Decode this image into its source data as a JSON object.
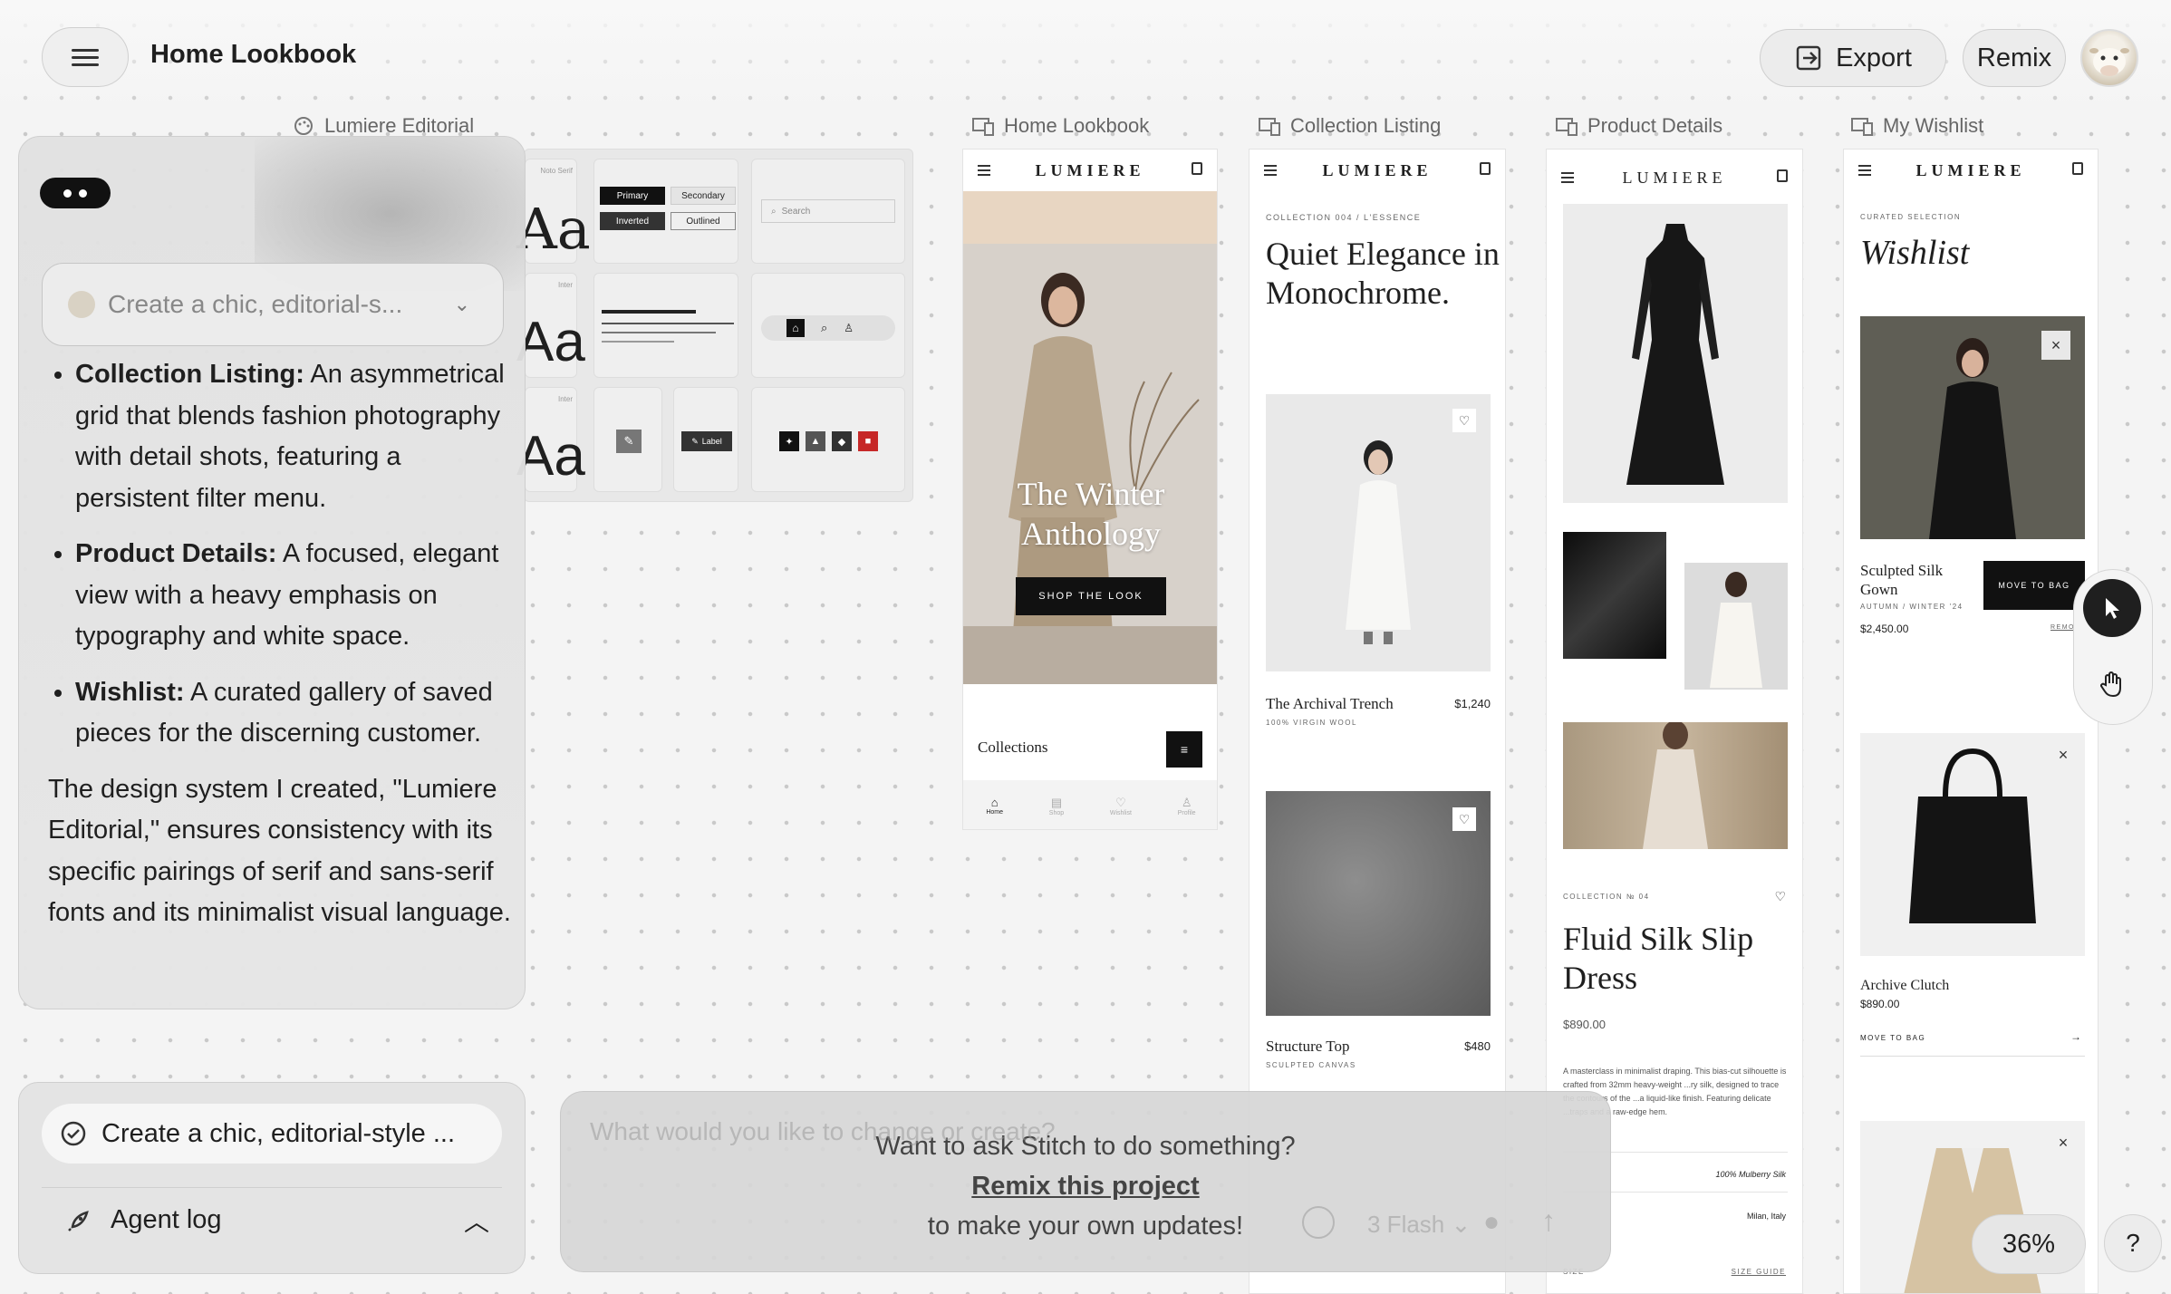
{
  "header": {
    "title": "Home Lookbook",
    "export_label": "Export",
    "remix_label": "Remix"
  },
  "frame_labels": {
    "design_system": "Lumiere Editorial",
    "home": "Home Lookbook",
    "collection": "Collection Listing",
    "product": "Product Details",
    "wishlist": "My Wishlist"
  },
  "design_system": {
    "font_samples": [
      "Aa",
      "Aa",
      "Aa"
    ],
    "font_captions": [
      "Noto Serif",
      "Inter",
      "Inter"
    ],
    "buttons": [
      "Primary",
      "Secondary",
      "Inverted",
      "Outlined"
    ],
    "search_placeholder": "Search",
    "label_chip": "Label"
  },
  "home_screen": {
    "brand": "LUMIERE",
    "hero_title": "The Winter Anthology",
    "hero_cta": "SHOP THE LOOK",
    "section": "Collections",
    "nav": [
      "Home",
      "Shop",
      "Wishlist",
      "Profile"
    ]
  },
  "collection_screen": {
    "brand": "LUMIERE",
    "eyebrow": "COLLECTION 004 / L'ESSENCE",
    "title": "Quiet Elegance in Monochrome.",
    "items": [
      {
        "name": "The Archival Trench",
        "price": "$1,240",
        "sub": "100% VIRGIN WOOL"
      },
      {
        "name": "Structure Top",
        "price": "$480",
        "sub": "SCULPTED CANVAS"
      }
    ]
  },
  "product_screen": {
    "brand": "LUMIERE",
    "eyebrow": "COLLECTION № 04",
    "title": "Fluid Silk Slip Dress",
    "price": "$890.00",
    "description": "A masterclass in minimalist draping. This bias-cut silhouette is crafted from 32mm heavy-weight ...ry silk, designed to trace the contours of the ...a liquid-like finish. Featuring delicate ...traps and a raw-edge hem.",
    "material": "100% Mulberry Silk",
    "origin": "Milan, Italy",
    "size_label": "SIZE",
    "size_guide": "SIZE GUIDE"
  },
  "wishlist_screen": {
    "brand": "LUMIERE",
    "eyebrow": "CURATED SELECTION",
    "title": "Wishlist",
    "items": [
      {
        "name": "Sculpted Silk Gown",
        "sub": "AUTUMN / WINTER '24",
        "price": "$2,450.00",
        "cta": "MOVE TO BAG",
        "remove": "REMO"
      },
      {
        "name": "Archive Clutch",
        "price": "$890.00",
        "cta": "MOVE TO BAG"
      }
    ]
  },
  "chat": {
    "prompt_selector": "Create a chic, editorial-s...",
    "bullets": [
      {
        "term": "Collection Listing:",
        "text": " An asymmetrical grid that blends fashion photography with detail shots, featuring a persistent filter menu."
      },
      {
        "term": "Product Details:",
        "text": " A focused, elegant view with a heavy emphasis on typography and white space."
      },
      {
        "term": "Wishlist:",
        "text": " A curated gallery of saved pieces for the discerning customer."
      }
    ],
    "summary": "The design system I created, \"Lumiere Editorial,\" ensures consistency with its specific pairings of serif and sans-serif fonts and its minimalist visual language."
  },
  "bottom": {
    "task": "Create a chic, editorial-style ...",
    "agent_log": "Agent log"
  },
  "remix_overlay": {
    "input_placeholder": "What would you like to change or create?",
    "question": "Want to ask Stitch to do something?",
    "link": "Remix this project",
    "tail": "to make your own updates!",
    "model": "3 Flash"
  },
  "zoom": "36%",
  "help": "?"
}
